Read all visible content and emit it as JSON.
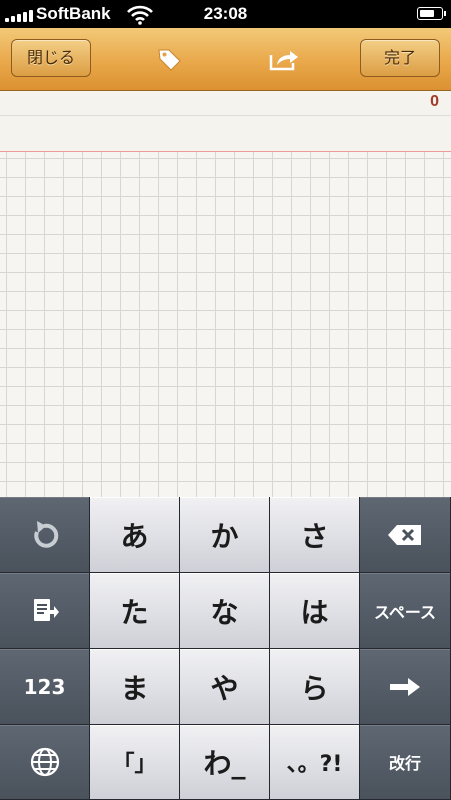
{
  "status_bar": {
    "carrier": "SoftBank",
    "time": "23:08",
    "battery_level": 0.8,
    "signal_bars": 5
  },
  "toolbar": {
    "close_label": "閉じる",
    "done_label": "完了",
    "tag_icon": "tag-icon",
    "share_icon": "share-icon"
  },
  "note": {
    "char_count": "0"
  },
  "keyboard": {
    "row1": {
      "undo_icon": "undo-icon",
      "k1": "あ",
      "k2": "か",
      "k3": "さ",
      "delete_icon": "delete-icon"
    },
    "row2": {
      "paste_icon": "paste-icon",
      "k1": "た",
      "k2": "な",
      "k3": "は",
      "space": "スペース"
    },
    "row3": {
      "numbers": "123",
      "k1": "ま",
      "k2": "や",
      "k3": "ら",
      "arrow_icon": "right-arrow-icon"
    },
    "row4": {
      "globe_icon": "globe-icon",
      "k1": "「」",
      "k2": "わ_",
      "k3": "、。?!",
      "return": "改行"
    }
  },
  "colors": {
    "toolbar": "#e9a84a",
    "paper": "#f6f5f1",
    "keyboard_dark": "#4a525c",
    "keyboard_light": "#e6e6ea",
    "char_count": "#a33a2a"
  }
}
